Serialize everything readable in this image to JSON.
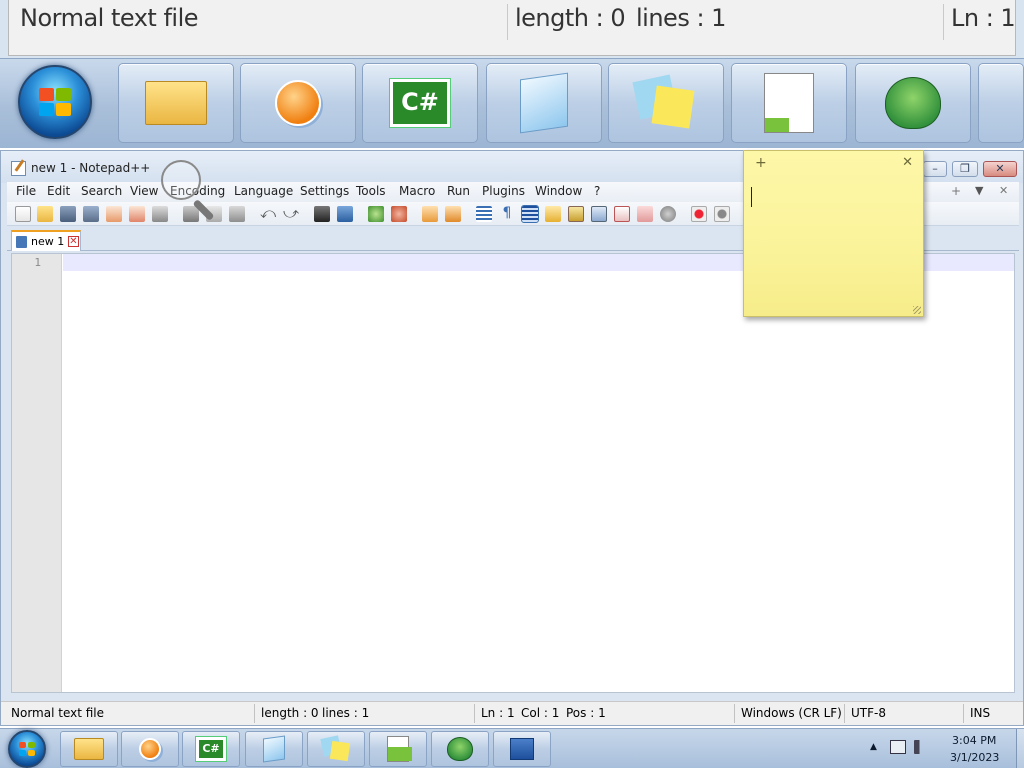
{
  "magnifier": {
    "status_type": "Normal text file",
    "status_length": "length : 0",
    "status_lines": "lines : 1",
    "status_ln": "Ln : 1"
  },
  "window": {
    "title": "new 1 - Notepad++",
    "controls": {
      "minimize": "–",
      "restore": "❐",
      "close": "✕"
    }
  },
  "menu": {
    "items": [
      "File",
      "Edit",
      "Search",
      "View",
      "Encoding",
      "Language",
      "Settings",
      "Tools",
      "Macro",
      "Run",
      "Plugins",
      "Window",
      "?"
    ],
    "right_controls": [
      "+",
      "▼",
      "✕"
    ]
  },
  "toolbar": {
    "icons": [
      "new-file",
      "open-file",
      "save",
      "save-all",
      "close",
      "close-all",
      "print",
      "cut",
      "copy",
      "paste",
      "undo",
      "redo",
      "find",
      "replace",
      "zoom-in",
      "zoom-out",
      "sync-vertical",
      "sync-horizontal",
      "word-wrap",
      "show-all-characters",
      "indent-guide",
      "user-defined-language",
      "doc-map",
      "function-list",
      "folder-as-workspace",
      "monitoring",
      "record-macro",
      "stop-recording"
    ]
  },
  "tabs": [
    {
      "label": "new 1",
      "close": "✕"
    }
  ],
  "editor": {
    "line_numbers": [
      "1"
    ]
  },
  "statusbar": {
    "type": "Normal text file",
    "length": "length : 0",
    "lines": "lines : 1",
    "ln": "Ln : 1",
    "col": "Col : 1",
    "pos": "Pos : 1",
    "eol": "Windows (CR LF)",
    "encoding": "UTF-8",
    "mode": "INS"
  },
  "sticky_note": {
    "add": "+",
    "close": "✕"
  },
  "taskbar": {
    "apps": [
      "start-orb",
      "windows-explorer",
      "windows-media-player",
      "csharp-app",
      "notepad",
      "sticky-notes",
      "notepad-plus-plus",
      "geckodriver",
      "magnifier"
    ],
    "tray": {
      "up_arrow": "▲",
      "time": "3:04 PM",
      "date": "3/1/2023"
    }
  },
  "colors": {
    "taskbar": "#a8bfdb",
    "window_frame": "#dbe5f1",
    "sticky_note": "#fbf39a",
    "current_line": "#e8e8ff",
    "tab_accent": "#f0a020"
  }
}
